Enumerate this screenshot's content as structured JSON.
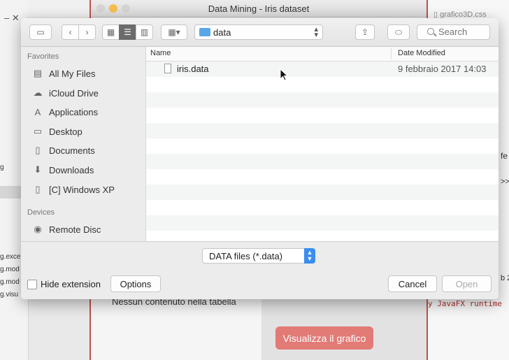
{
  "background": {
    "left_fragments": [
      "g",
      "g.exce",
      "g.mod",
      "g.mod",
      "g.visu"
    ],
    "right_tab": "grafico3D.css",
    "right_fragments": [
      "fe",
      ">>",
      "b 2"
    ],
    "runtime_text": "y JavaFX runtime",
    "app_title": "Data Mining - Iris dataset",
    "empty_table_text": "Nessun contenuto nella tabella",
    "viz_button": "Visualizza il grafico"
  },
  "toolbar": {
    "path_folder": "data",
    "search_placeholder": "Search"
  },
  "sidebar": {
    "favorites_title": "Favorites",
    "favorites": [
      {
        "label": "All My Files",
        "icon": "all-files-icon"
      },
      {
        "label": "iCloud Drive",
        "icon": "cloud-icon"
      },
      {
        "label": "Applications",
        "icon": "applications-icon"
      },
      {
        "label": "Desktop",
        "icon": "desktop-icon"
      },
      {
        "label": "Documents",
        "icon": "documents-icon"
      },
      {
        "label": "Downloads",
        "icon": "downloads-icon"
      },
      {
        "label": "[C] Windows XP",
        "icon": "drive-icon"
      }
    ],
    "devices_title": "Devices",
    "devices": [
      {
        "label": "Remote Disc",
        "icon": "disc-icon"
      }
    ]
  },
  "file_list": {
    "col_name": "Name",
    "col_date": "Date Modified",
    "files": [
      {
        "name": "iris.data",
        "date": "9 febbraio 2017 14:03"
      }
    ]
  },
  "bottom": {
    "format": "DATA files (*.data)",
    "hide_extension": "Hide extension",
    "options": "Options",
    "cancel": "Cancel",
    "open": "Open"
  }
}
